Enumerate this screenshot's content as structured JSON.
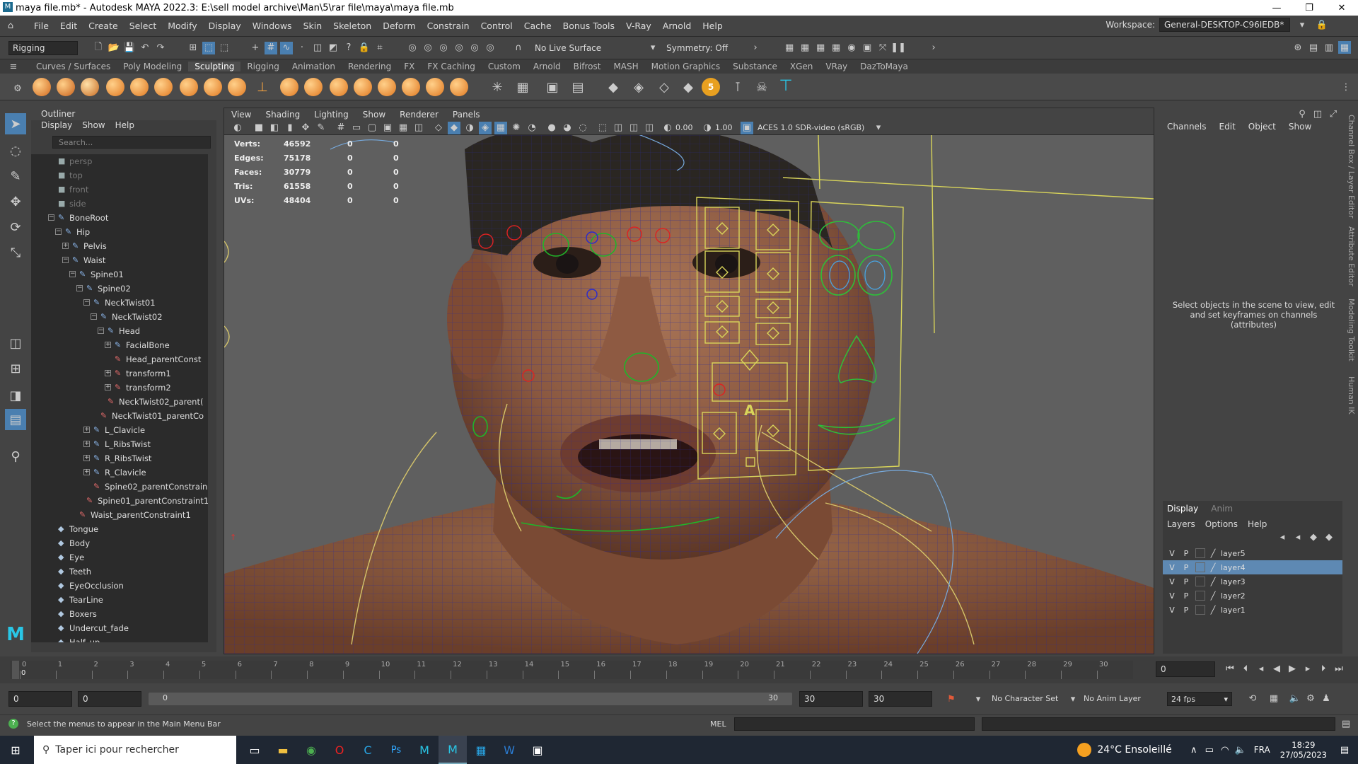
{
  "title": "maya file.mb* - Autodesk MAYA 2022.3: E:\\sell model archive\\Man\\5\\rar file\\maya\\maya file.mb",
  "window_controls": [
    "—",
    "❐",
    "✕"
  ],
  "menu": [
    "File",
    "Edit",
    "Create",
    "Select",
    "Modify",
    "Display",
    "Windows",
    "Skin",
    "Skeleton",
    "Deform",
    "Constrain",
    "Control",
    "Cache",
    "Bonus Tools",
    "V-Ray",
    "Arnold",
    "Help"
  ],
  "workspace": {
    "label": "Workspace:",
    "value": "General-DESKTOP-C96IEDB*"
  },
  "status": {
    "mode": "Rigging",
    "live_surface": "No Live Surface",
    "symmetry": "Symmetry: Off"
  },
  "shelf_tabs": [
    "Curves / Surfaces",
    "Poly Modeling",
    "Sculpting",
    "Rigging",
    "Animation",
    "Rendering",
    "FX",
    "FX Caching",
    "Custom",
    "Arnold",
    "Bifrost",
    "MASH",
    "Motion Graphics",
    "Substance",
    "XGen",
    "VRay",
    "DazToMaya"
  ],
  "shelf_active": "Sculpting",
  "outliner": {
    "title": "Outliner",
    "menu": [
      "Display",
      "Show",
      "Help"
    ],
    "search_placeholder": "Search...",
    "items": [
      {
        "label": "persp",
        "type": "cam",
        "d": 0,
        "exp": ""
      },
      {
        "label": "top",
        "type": "cam",
        "d": 0,
        "exp": ""
      },
      {
        "label": "front",
        "type": "cam",
        "d": 0,
        "exp": ""
      },
      {
        "label": "side",
        "type": "cam",
        "d": 0,
        "exp": ""
      },
      {
        "label": "BoneRoot",
        "type": "joint",
        "d": 0,
        "exp": "−"
      },
      {
        "label": "Hip",
        "type": "joint",
        "d": 1,
        "exp": "−"
      },
      {
        "label": "Pelvis",
        "type": "joint",
        "d": 2,
        "exp": "+"
      },
      {
        "label": "Waist",
        "type": "joint",
        "d": 2,
        "exp": "−"
      },
      {
        "label": "Spine01",
        "type": "joint",
        "d": 3,
        "exp": "−"
      },
      {
        "label": "Spine02",
        "type": "joint",
        "d": 4,
        "exp": "−"
      },
      {
        "label": "NeckTwist01",
        "type": "joint",
        "d": 5,
        "exp": "−"
      },
      {
        "label": "NeckTwist02",
        "type": "joint",
        "d": 6,
        "exp": "−"
      },
      {
        "label": "Head",
        "type": "joint",
        "d": 7,
        "exp": "−"
      },
      {
        "label": "FacialBone",
        "type": "joint",
        "d": 8,
        "exp": "+"
      },
      {
        "label": "Head_parentConst",
        "type": "constraint",
        "d": 8,
        "exp": ""
      },
      {
        "label": "transform1",
        "type": "xform",
        "d": 8,
        "exp": "+"
      },
      {
        "label": "transform2",
        "type": "xform",
        "d": 8,
        "exp": "+"
      },
      {
        "label": "NeckTwist02_parent(",
        "type": "constraint",
        "d": 7,
        "exp": ""
      },
      {
        "label": "NeckTwist01_parentCo",
        "type": "constraint",
        "d": 6,
        "exp": ""
      },
      {
        "label": "L_Clavicle",
        "type": "joint",
        "d": 5,
        "exp": "+"
      },
      {
        "label": "L_RibsTwist",
        "type": "joint",
        "d": 5,
        "exp": "+"
      },
      {
        "label": "R_RibsTwist",
        "type": "joint",
        "d": 5,
        "exp": "+"
      },
      {
        "label": "R_Clavicle",
        "type": "joint",
        "d": 5,
        "exp": "+"
      },
      {
        "label": "Spine02_parentConstrain",
        "type": "constraint",
        "d": 5,
        "exp": ""
      },
      {
        "label": "Spine01_parentConstraint1",
        "type": "constraint",
        "d": 4,
        "exp": ""
      },
      {
        "label": "Waist_parentConstraint1",
        "type": "constraint",
        "d": 3,
        "exp": ""
      },
      {
        "label": "Tongue",
        "type": "mesh",
        "d": 0,
        "exp": ""
      },
      {
        "label": "Body",
        "type": "mesh",
        "d": 0,
        "exp": ""
      },
      {
        "label": "Eye",
        "type": "mesh",
        "d": 0,
        "exp": ""
      },
      {
        "label": "Teeth",
        "type": "mesh",
        "d": 0,
        "exp": ""
      },
      {
        "label": "EyeOcclusion",
        "type": "mesh",
        "d": 0,
        "exp": ""
      },
      {
        "label": "TearLine",
        "type": "mesh",
        "d": 0,
        "exp": ""
      },
      {
        "label": "Boxers",
        "type": "mesh",
        "d": 0,
        "exp": ""
      },
      {
        "label": "Undercut_fade",
        "type": "mesh",
        "d": 0,
        "exp": ""
      },
      {
        "label": "Half_up",
        "type": "mesh",
        "d": 0,
        "exp": ""
      }
    ]
  },
  "viewport": {
    "menu": [
      "View",
      "Shading",
      "Lighting",
      "Show",
      "Renderer",
      "Panels"
    ],
    "exposure": "0.00",
    "gamma": "1.00",
    "colorspace": "ACES 1.0 SDR-video (sRGB)",
    "hud": [
      {
        "label": "Verts:",
        "a": "46592",
        "b": "0",
        "c": "0"
      },
      {
        "label": "Edges:",
        "a": "75178",
        "b": "0",
        "c": "0"
      },
      {
        "label": "Faces:",
        "a": "30779",
        "b": "0",
        "c": "0"
      },
      {
        "label": "Tris:",
        "a": "61558",
        "b": "0",
        "c": "0"
      },
      {
        "label": "UVs:",
        "a": "48404",
        "b": "0",
        "c": "0"
      }
    ],
    "board_letter": "A"
  },
  "channelbox": {
    "menu": [
      "Channels",
      "Edit",
      "Object",
      "Show"
    ],
    "message": "Select objects in the scene to view, edit and set keyframes on channels (attributes)"
  },
  "side_tabs": [
    "Channel Box / Layer Editor",
    "Attribute Editor",
    "Modeling Toolkit",
    "Human IK"
  ],
  "layers": {
    "tabs": [
      "Display",
      "Anim"
    ],
    "menu": [
      "Layers",
      "Options",
      "Help"
    ],
    "rows": [
      {
        "v": "V",
        "p": "P",
        "name": "layer5",
        "selected": false
      },
      {
        "v": "V",
        "p": "P",
        "name": "layer4",
        "selected": true
      },
      {
        "v": "V",
        "p": "P",
        "name": "layer3",
        "selected": false
      },
      {
        "v": "V",
        "p": "P",
        "name": "layer2",
        "selected": false
      },
      {
        "v": "V",
        "p": "P",
        "name": "layer1",
        "selected": false
      }
    ]
  },
  "timeline": {
    "ticks": [
      "0",
      "1",
      "2",
      "3",
      "4",
      "5",
      "6",
      "7",
      "8",
      "9",
      "10",
      "11",
      "12",
      "13",
      "14",
      "15",
      "16",
      "17",
      "18",
      "19",
      "20",
      "21",
      "22",
      "23",
      "24",
      "25",
      "26",
      "27",
      "28",
      "29",
      "30"
    ],
    "current": "0",
    "frame_field": "0"
  },
  "range": {
    "start": "0",
    "start2": "0",
    "slider_start": "0",
    "slider_end": "30",
    "end1": "30",
    "end2": "30",
    "character": "No Character Set",
    "anim_layer": "No Anim Layer",
    "fps": "24 fps"
  },
  "cmdline": {
    "help": "Select the menus to appear in the Main Menu Bar",
    "lang": "MEL"
  },
  "taskbar": {
    "search": "Taper ici pour rechercher",
    "weather": "24°C Ensoleillé",
    "lang": "FRA",
    "time": "18:29",
    "date": "27/05/2023"
  },
  "colors": {
    "accent": "#5e89b3",
    "active_tool": "#4a7fb0",
    "cyan": "#29c6e6"
  }
}
